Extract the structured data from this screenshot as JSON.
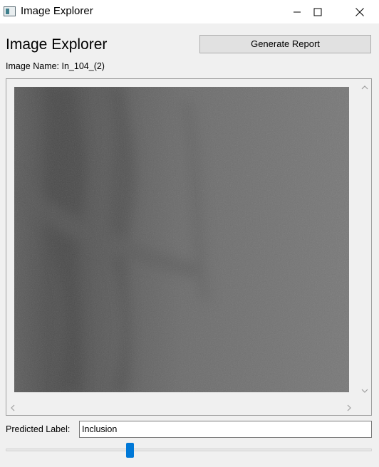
{
  "window": {
    "title": "Image Explorer"
  },
  "header": {
    "title": "Image Explorer",
    "generate_report_label": "Generate Report"
  },
  "image": {
    "name_text": "Image Name: In_104_(2)"
  },
  "prediction": {
    "label": "Predicted Label:",
    "value": "Inclusion"
  },
  "slider": {
    "value_fraction": 0.335
  },
  "colors": {
    "accent": "#0078d7",
    "background": "#f0f0f0",
    "image_base": "#6b6b6b"
  }
}
